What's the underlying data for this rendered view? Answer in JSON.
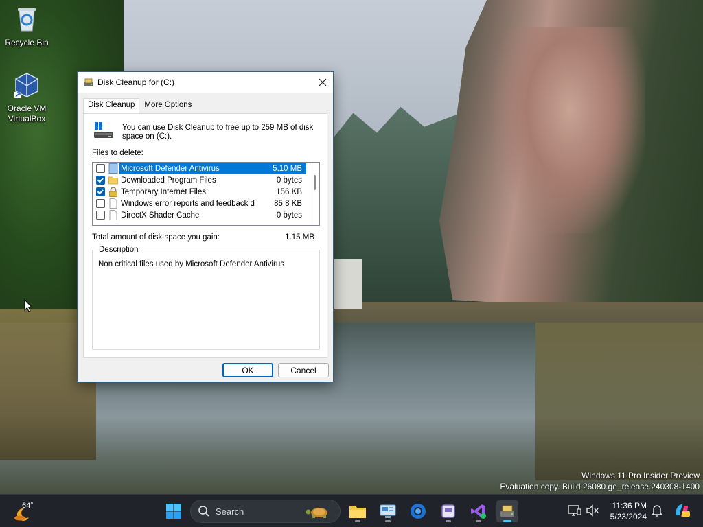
{
  "desktop": {
    "icons": [
      {
        "label": "Recycle Bin"
      },
      {
        "label": "Oracle VM VirtualBox"
      }
    ],
    "watermark": {
      "line1": "Windows 11 Pro Insider Preview",
      "line2": "Evaluation copy. Build 26080.ge_release.240308-1400"
    }
  },
  "dialog": {
    "title": "Disk Cleanup for  (C:)",
    "tabs": [
      "Disk Cleanup",
      "More Options"
    ],
    "intro": "You can use Disk Cleanup to free up to 259 MB of disk space on  (C:).",
    "files_label": "Files to delete:",
    "files": [
      {
        "name": "Microsoft Defender Antivirus",
        "size": "5.10 MB",
        "checked": false,
        "selected": true
      },
      {
        "name": "Downloaded Program Files",
        "size": "0 bytes",
        "checked": true,
        "selected": false
      },
      {
        "name": "Temporary Internet Files",
        "size": "156 KB",
        "checked": true,
        "selected": false
      },
      {
        "name": "Windows error reports and feedback di...",
        "size": "85.8 KB",
        "checked": false,
        "selected": false
      },
      {
        "name": "DirectX Shader Cache",
        "size": "0 bytes",
        "checked": false,
        "selected": false
      }
    ],
    "total_label": "Total amount of disk space you gain:",
    "total_value": "1.15 MB",
    "description_label": "Description",
    "description_text": "Non critical files used by Microsoft Defender Antivirus",
    "ok_label": "OK",
    "cancel_label": "Cancel"
  },
  "taskbar": {
    "weather_temp": "64°",
    "search_placeholder": "Search",
    "clock_time": "11:36 PM",
    "clock_date": "5/23/2024"
  },
  "colors": {
    "selection": "#0078d7",
    "accent": "#0067c0",
    "taskbar": "#20242a"
  }
}
